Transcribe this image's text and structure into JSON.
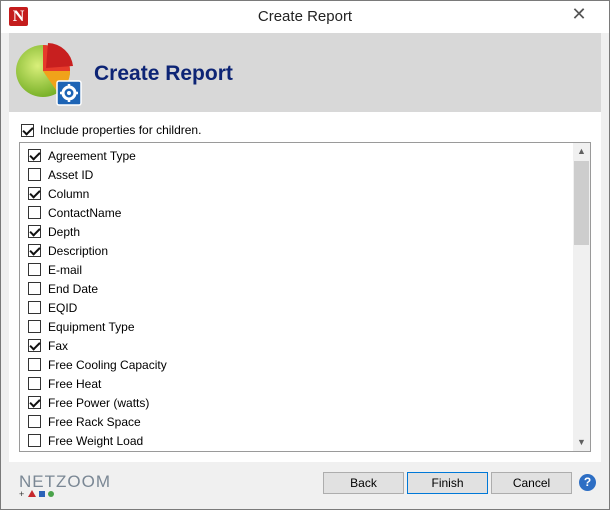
{
  "window": {
    "title": "Create Report",
    "app_icon_glyph": "N",
    "close_glyph": "✕"
  },
  "banner": {
    "title": "Create Report",
    "logo_icon": "pie-chart-gear-icon"
  },
  "include_children": {
    "label": "Include properties for children.",
    "checked": true
  },
  "properties": [
    {
      "label": "Agreement Type",
      "checked": true
    },
    {
      "label": "Asset ID",
      "checked": false
    },
    {
      "label": "Column",
      "checked": true
    },
    {
      "label": "ContactName",
      "checked": false
    },
    {
      "label": "Depth",
      "checked": true
    },
    {
      "label": "Description",
      "checked": true
    },
    {
      "label": "E-mail",
      "checked": false
    },
    {
      "label": "End Date",
      "checked": false
    },
    {
      "label": "EQID",
      "checked": false
    },
    {
      "label": "Equipment Type",
      "checked": false
    },
    {
      "label": "Fax",
      "checked": true
    },
    {
      "label": "Free Cooling Capacity",
      "checked": false
    },
    {
      "label": "Free Heat",
      "checked": false
    },
    {
      "label": "Free Power (watts)",
      "checked": true
    },
    {
      "label": "Free Rack Space",
      "checked": false
    },
    {
      "label": "Free Weight Load",
      "checked": false
    }
  ],
  "scrollbar": {
    "up_glyph": "▲",
    "down_glyph": "▼"
  },
  "footer": {
    "brand": "NETZOOM",
    "buttons": {
      "back": "Back",
      "finish": "Finish",
      "cancel": "Cancel"
    },
    "help_glyph": "?"
  },
  "colors": {
    "banner_title": "#0d2475",
    "app_icon": "#c41c1c",
    "help": "#2d6ec4",
    "focus_border": "#0078d7"
  }
}
